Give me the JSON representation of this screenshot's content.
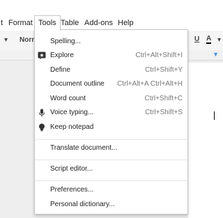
{
  "menubar": {
    "items": [
      {
        "label": "Format"
      },
      {
        "label": "Tools"
      },
      {
        "label": "Table"
      },
      {
        "label": "Add-ons"
      },
      {
        "label": "Help"
      }
    ],
    "truncated_prefix": "t"
  },
  "toolbar": {
    "style_label": "Norm",
    "underline_label": "U",
    "text_color_label": "A"
  },
  "tools_menu": {
    "items": [
      {
        "label": "Spelling...",
        "shortcut": ""
      },
      {
        "label": "Explore",
        "shortcut": "Ctrl+Alt+Shift+I",
        "icon": "explore-icon"
      },
      {
        "label": "Define",
        "shortcut": "Ctrl+Shift+Y"
      },
      {
        "label": "Document outline",
        "shortcut": "Ctrl+Alt+A Ctrl+Alt+H"
      },
      {
        "label": "Word count",
        "shortcut": "Ctrl+Shift+C"
      },
      {
        "label": "Voice typing...",
        "shortcut": "Ctrl+Shift+S",
        "icon": "microphone-icon"
      },
      {
        "label": "Keep notepad",
        "shortcut": "",
        "icon": "lightbulb-icon"
      },
      {
        "label": "Translate document...",
        "shortcut": ""
      },
      {
        "label": "Script editor...",
        "shortcut": ""
      },
      {
        "label": "Preferences...",
        "shortcut": ""
      },
      {
        "label": "Personal dictionary...",
        "shortcut": ""
      }
    ]
  },
  "colors": {
    "menu_border": "#c6c6c6",
    "shortcut_text": "#777777",
    "text_color_underline": "#000000"
  }
}
